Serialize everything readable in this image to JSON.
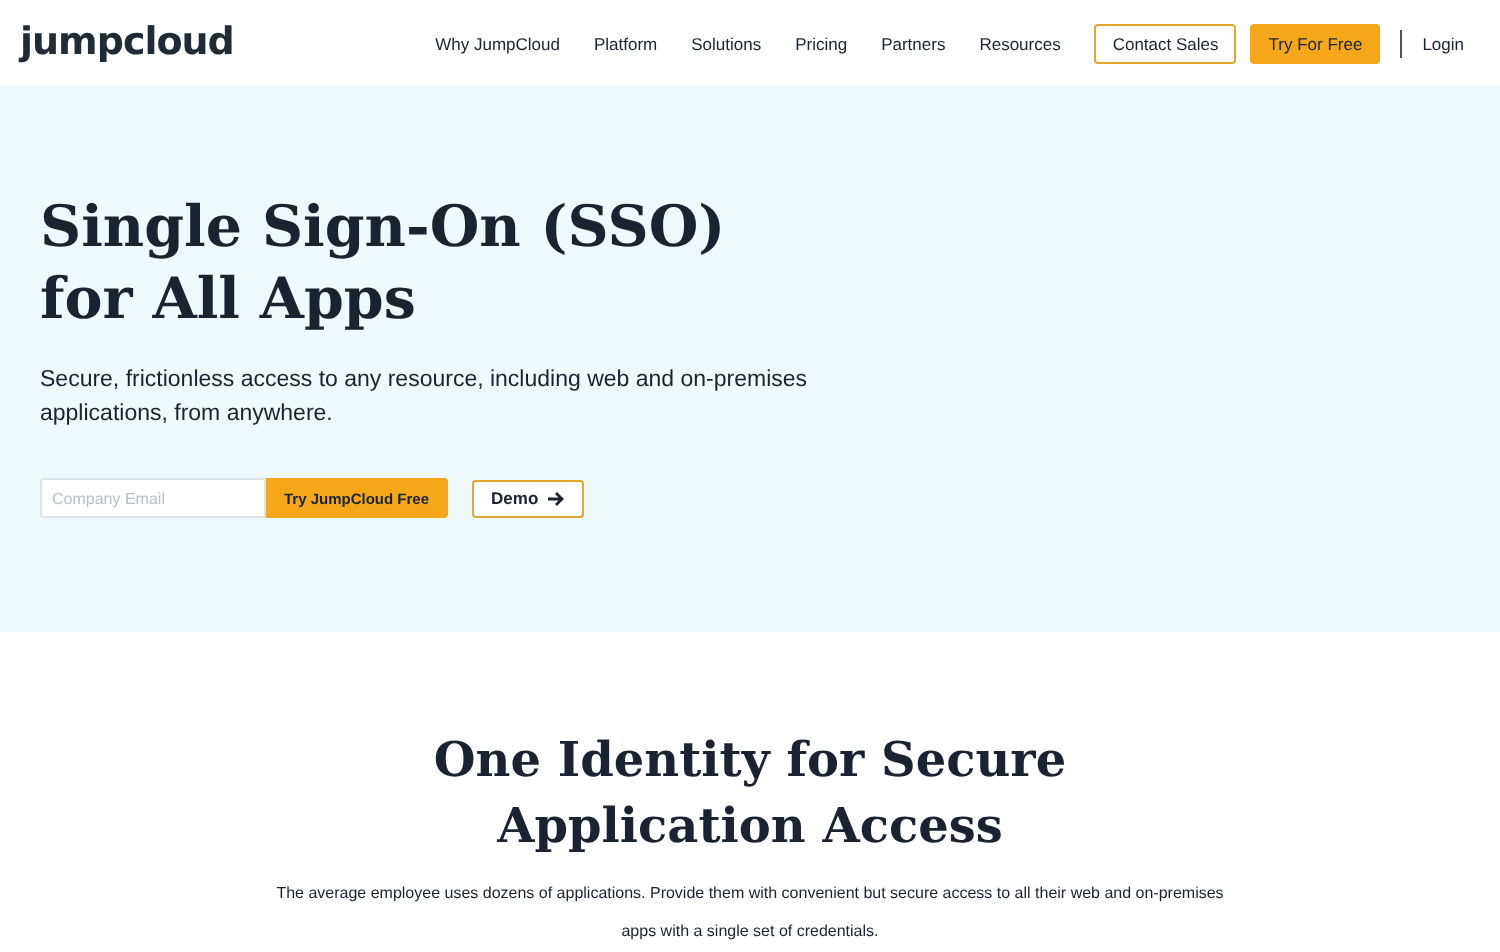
{
  "header": {
    "logo": "jumpcloud",
    "nav": [
      "Why JumpCloud",
      "Platform",
      "Solutions",
      "Pricing",
      "Partners",
      "Resources"
    ],
    "contact_button": "Contact Sales",
    "try_button": "Try For Free",
    "login": "Login"
  },
  "hero": {
    "title_lines": [
      "Single Sign-On (SSO)",
      "for All Apps"
    ],
    "subtitle": "Secure, frictionless access to any resource, including web and on-premises applications, from anywhere.",
    "email_field": {
      "placeholder": "Company Email"
    },
    "submit_button": "Try JumpCloud Free",
    "demo_button": "Demo"
  },
  "section": {
    "title": "One Identity for Secure Application Access",
    "body": "The average employee uses dozens of applications. Provide them with convenient but secure access to all their web and on-premises apps with a single set of credentials."
  }
}
